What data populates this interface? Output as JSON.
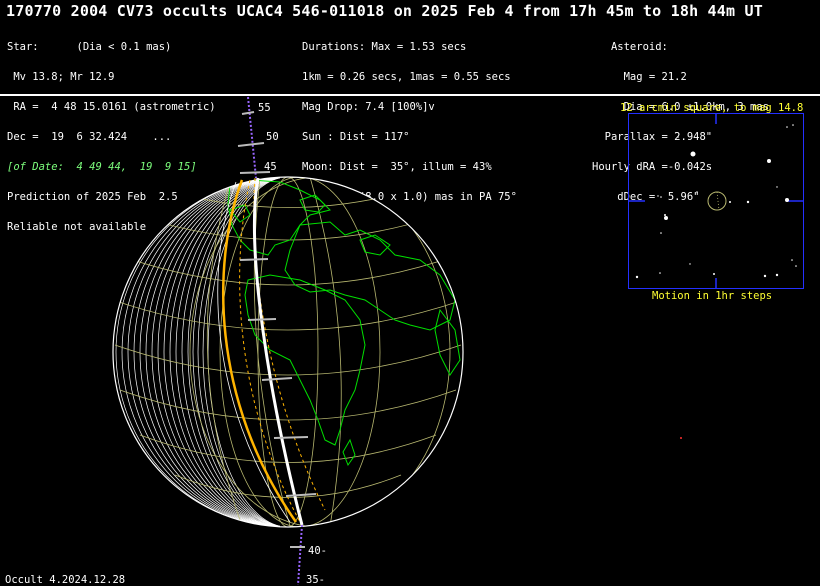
{
  "title": "170770 2004 CV73 occults UCAC4 546-011018 on 2025 Feb  4 from 17h 45m to 18h 44m UT",
  "star": {
    "lines": [
      "Star:      (Dia < 0.1 mas)",
      " Mv 13.8; Mr 12.9",
      " RA =  4 48 15.0161 (astrometric)",
      "Dec =  19  6 32.424    ...",
      "[of Date:  4 49 44,  19  9 15]",
      "Prediction of 2025 Feb  2.5",
      "Reliable not available"
    ]
  },
  "event": {
    "lines": [
      "Durations: Max = 1.53 secs",
      "1km = 0.26 secs, 1mas = 0.55 secs",
      "Mag Drop: 7.4 [100%]v",
      "Sun : Dist = 117°",
      "Moon: Dist =  35°, illum = 43%",
      "1σ Err: ±(8.0 x 1.0) mas in PA 75°"
    ]
  },
  "asteroid": {
    "lines": [
      "   Asteroid:",
      "     Mag = 21.2",
      "     Dia = 6.0 ±1.0km, 3 mas",
      "  Parallax = 2.948\"",
      "Hourly dRA =-0.042s",
      "    dDec =  5.96\""
    ]
  },
  "star_chart": {
    "title": "12 arcmin square, to mag 14.8",
    "caption": "Motion in 1hr steps"
  },
  "path_labels": {
    "lat_55": "55",
    "lat_50": "50",
    "lat_45": "45",
    "lat_40": "40-",
    "lat_35": "35-"
  },
  "footer": "Occult 4.2024.12.28",
  "colors": {
    "background": "#000000",
    "land_outline": "#00e000",
    "graticule": "#b8b870",
    "path": "#ffffff",
    "sigma_limit": "#ffb400",
    "starbox_border": "#2430ff",
    "starbox_text": "#ffff33",
    "date_text": "#7CFC7C"
  }
}
